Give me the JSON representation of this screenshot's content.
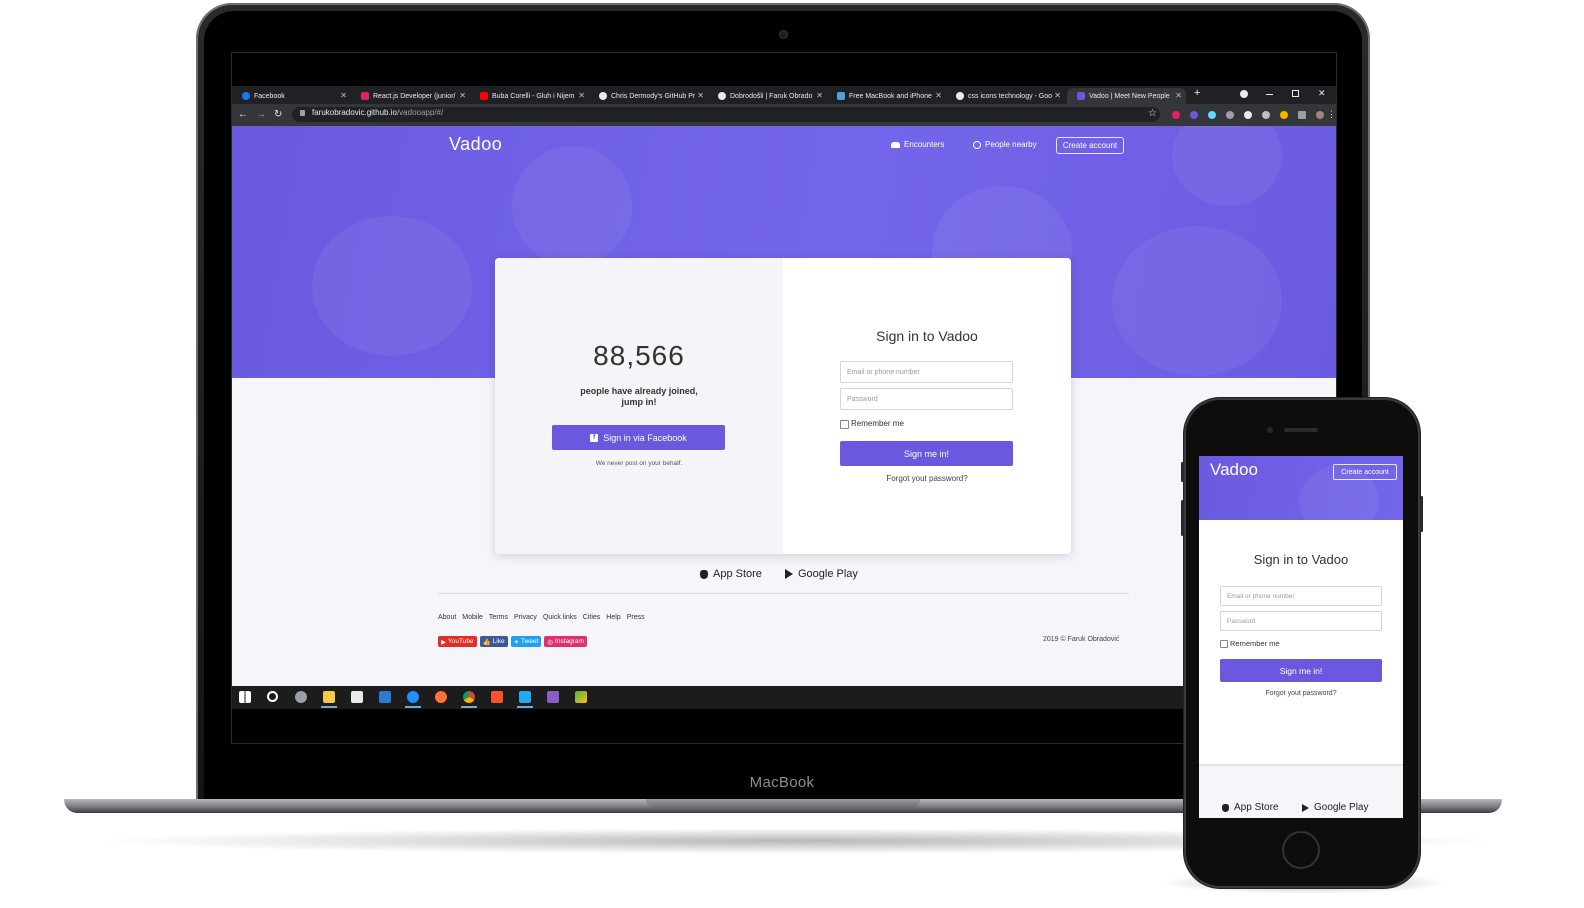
{
  "device_labels": {
    "laptop": "MacBook"
  },
  "browser": {
    "tabs": [
      {
        "title": "Facebook",
        "color": "#1877f2"
      },
      {
        "title": "React.js Developer (junior/",
        "color": "#e0245e"
      },
      {
        "title": "Buba Corelli - Gluh i Nijem",
        "color": "#ff0000"
      },
      {
        "title": "Chris Dermody's GitHub Pr",
        "color": "#e8eaed"
      },
      {
        "title": "Dobrodošli | Faruk Obrado",
        "color": "#e8eaed"
      },
      {
        "title": "Free MacBook and iPhone",
        "color": "#4aa3df"
      },
      {
        "title": "css icons technology - Goo",
        "color": "#e8eaed"
      },
      {
        "title": "Vadoo | Meet New People",
        "color": "#6a59df"
      }
    ],
    "tab_close": "✕",
    "new_tab": "+",
    "url_host": "farukobradovic.github.io",
    "url_path": "/vadooapp/#/"
  },
  "site": {
    "logo": "Vadoo",
    "nav": {
      "encounters": "Encounters",
      "people_nearby": "People nearby",
      "create_account": "Create account"
    },
    "left_panel": {
      "count": "88,566",
      "joined_line1": "people have already joined,",
      "joined_line2": "jump in!",
      "facebook_button": "Sign in via Facebook",
      "never_post": "We never post on your behalf."
    },
    "signin": {
      "title": "Sign in to Vadoo",
      "email_placeholder": "Email or phone number",
      "password_placeholder": "Password",
      "remember_me": "Remember me",
      "submit": "Sign me in!",
      "forgot": "Forgot yout password?"
    },
    "stores": {
      "app_store": "App Store",
      "google_play": "Google Play"
    },
    "footer_links": [
      "About",
      "Mobile",
      "Terms",
      "Privacy",
      "Quick links",
      "Cities",
      "Help",
      "Press"
    ],
    "social": [
      {
        "label": "YouTube",
        "color": "#e52d27"
      },
      {
        "label": "Like",
        "color": "#3b5998"
      },
      {
        "label": "Tweet",
        "color": "#1da1f2"
      },
      {
        "label": "Instagram",
        "color": "#e1306c"
      }
    ],
    "copyright": "2019 © Faruk Obradović"
  },
  "taskbar_icons": [
    "windows-start-icon",
    "search-icon",
    "taskbar-app-icon",
    "file-explorer-icon",
    "store-icon",
    "mail-icon",
    "edge-icon",
    "firefox-icon",
    "chrome-icon",
    "brave-icon",
    "vscode-icon",
    "visual-studio-icon",
    "terminal-icon"
  ],
  "colors": {
    "brand": "#6a59df",
    "page_bg": "#f6f6fa"
  }
}
